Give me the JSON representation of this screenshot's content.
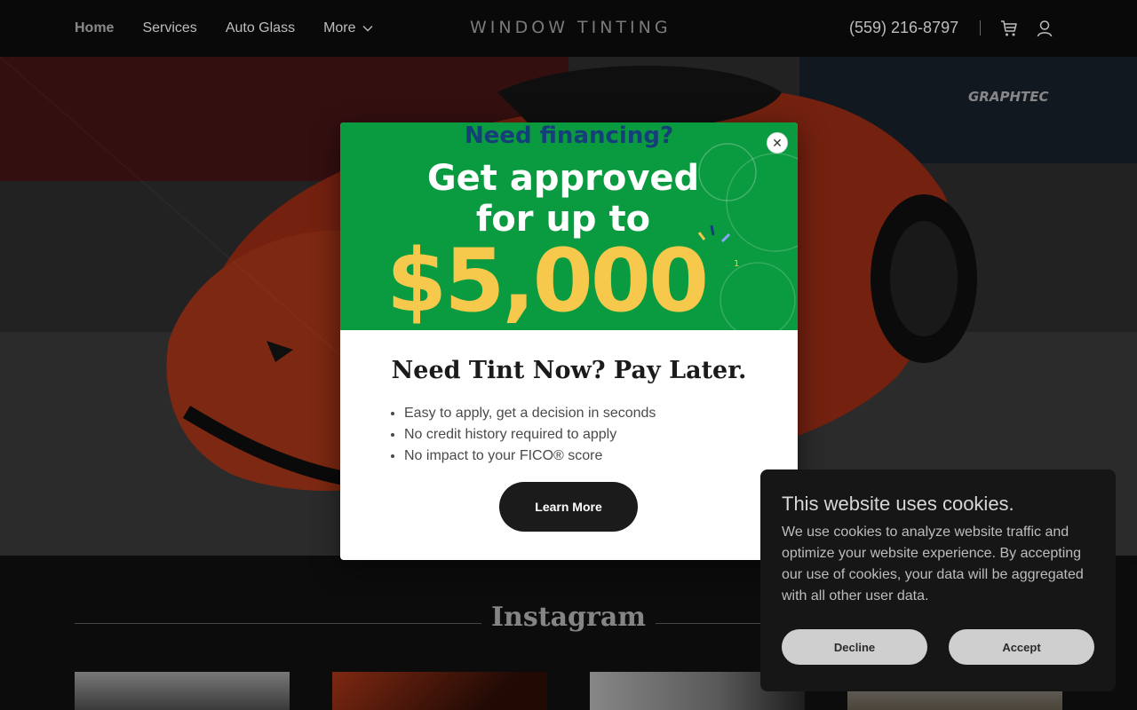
{
  "header": {
    "nav": [
      {
        "label": "Home",
        "active": true
      },
      {
        "label": "Services"
      },
      {
        "label": "Auto Glass"
      },
      {
        "label": "More"
      }
    ],
    "logo": "WINDOW TINTING",
    "phone": "(559) 216-8797",
    "icons": [
      "chevron-down-icon",
      "cart-icon",
      "user-icon"
    ]
  },
  "hero": {
    "wall_sign": "GRAPHTEC"
  },
  "modal": {
    "banner": {
      "top_text": "Need financing?",
      "line1": "Get approved",
      "line2": "for up to",
      "amount": "$5,000",
      "footnote": "1"
    },
    "title": "Need Tint Now? Pay Later.",
    "bullets": [
      "Easy to apply, get a decision in seconds",
      "No credit history required to apply",
      "No impact to your FICO® score"
    ],
    "cta_label": "Learn More",
    "close_icon": "close-icon"
  },
  "instagram": {
    "title": "Instagram"
  },
  "cookie": {
    "title": "This website uses cookies.",
    "text": "We use cookies to analyze website traffic and optimize your website experience. By accepting our use of cookies, your data will be aggregated with all other user data.",
    "decline_label": "Decline",
    "accept_label": "Accept"
  },
  "colors": {
    "banner_green": "#0a9a3f",
    "banner_blue": "#153f79",
    "banner_yellow": "#f6c84c",
    "car_red": "#e0431d"
  }
}
